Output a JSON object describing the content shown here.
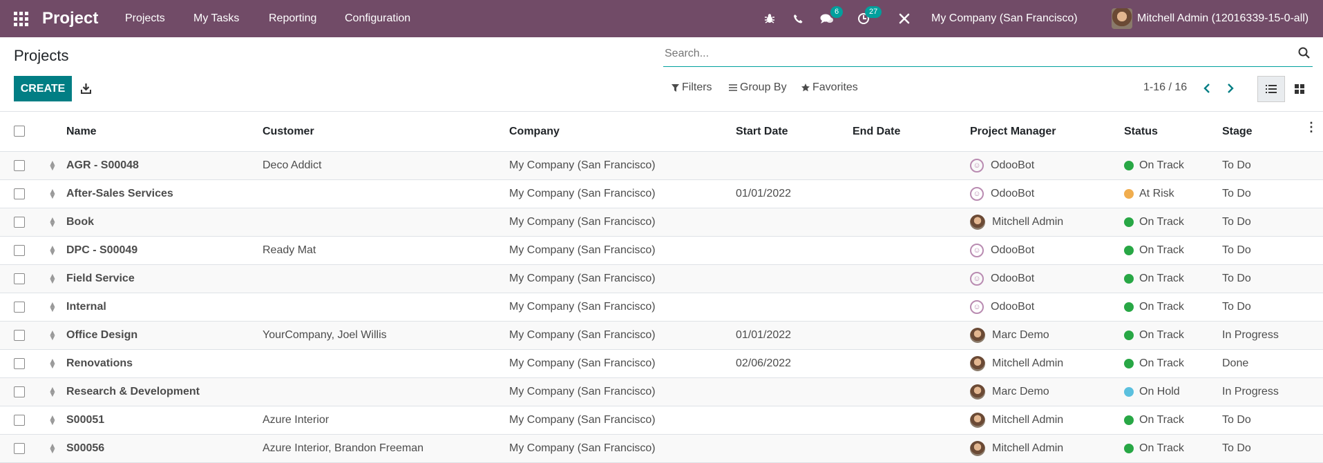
{
  "navbar": {
    "app_title": "Project",
    "menu": [
      "Projects",
      "My Tasks",
      "Reporting",
      "Configuration"
    ],
    "messages_count": "6",
    "activities_count": "27",
    "company": "My Company (San Francisco)",
    "user": "Mitchell Admin (12016339-15-0-all)"
  },
  "control_panel": {
    "title": "Projects",
    "create_label": "CREATE",
    "search_placeholder": "Search...",
    "filters_label": "Filters",
    "groupby_label": "Group By",
    "favorites_label": "Favorites",
    "pager": "1-16 / 16"
  },
  "table": {
    "columns": [
      "Name",
      "Customer",
      "Company",
      "Start Date",
      "End Date",
      "Project Manager",
      "Status",
      "Stage"
    ],
    "rows": [
      {
        "name": "AGR - S00048",
        "customer": "Deco Addict",
        "company": "My Company (San Francisco)",
        "start": "",
        "end": "",
        "manager": "OdooBot",
        "manager_avatar": "bot",
        "status": "On Track",
        "status_color": "#28a745",
        "stage": "To Do"
      },
      {
        "name": "After-Sales Services",
        "customer": "",
        "company": "My Company (San Francisco)",
        "start": "01/01/2022",
        "end": "",
        "manager": "OdooBot",
        "manager_avatar": "bot",
        "status": "At Risk",
        "status_color": "#f0ad4e",
        "stage": "To Do"
      },
      {
        "name": "Book",
        "customer": "",
        "company": "My Company (San Francisco)",
        "start": "",
        "end": "",
        "manager": "Mitchell Admin",
        "manager_avatar": "photo",
        "status": "On Track",
        "status_color": "#28a745",
        "stage": "To Do"
      },
      {
        "name": "DPC - S00049",
        "customer": "Ready Mat",
        "company": "My Company (San Francisco)",
        "start": "",
        "end": "",
        "manager": "OdooBot",
        "manager_avatar": "bot",
        "status": "On Track",
        "status_color": "#28a745",
        "stage": "To Do"
      },
      {
        "name": "Field Service",
        "customer": "",
        "company": "My Company (San Francisco)",
        "start": "",
        "end": "",
        "manager": "OdooBot",
        "manager_avatar": "bot",
        "status": "On Track",
        "status_color": "#28a745",
        "stage": "To Do"
      },
      {
        "name": "Internal",
        "customer": "",
        "company": "My Company (San Francisco)",
        "start": "",
        "end": "",
        "manager": "OdooBot",
        "manager_avatar": "bot",
        "status": "On Track",
        "status_color": "#28a745",
        "stage": "To Do"
      },
      {
        "name": "Office Design",
        "customer": "YourCompany, Joel Willis",
        "company": "My Company (San Francisco)",
        "start": "01/01/2022",
        "end": "",
        "manager": "Marc Demo",
        "manager_avatar": "photo",
        "status": "On Track",
        "status_color": "#28a745",
        "stage": "In Progress"
      },
      {
        "name": "Renovations",
        "customer": "",
        "company": "My Company (San Francisco)",
        "start": "02/06/2022",
        "end": "",
        "manager": "Mitchell Admin",
        "manager_avatar": "photo",
        "status": "On Track",
        "status_color": "#28a745",
        "stage": "Done"
      },
      {
        "name": "Research & Development",
        "customer": "",
        "company": "My Company (San Francisco)",
        "start": "",
        "end": "",
        "manager": "Marc Demo",
        "manager_avatar": "photo",
        "status": "On Hold",
        "status_color": "#5bc0de",
        "stage": "In Progress"
      },
      {
        "name": "S00051",
        "customer": "Azure Interior",
        "company": "My Company (San Francisco)",
        "start": "",
        "end": "",
        "manager": "Mitchell Admin",
        "manager_avatar": "photo",
        "status": "On Track",
        "status_color": "#28a745",
        "stage": "To Do"
      },
      {
        "name": "S00056",
        "customer": "Azure Interior, Brandon Freeman",
        "company": "My Company (San Francisco)",
        "start": "",
        "end": "",
        "manager": "Mitchell Admin",
        "manager_avatar": "photo",
        "status": "On Track",
        "status_color": "#28a745",
        "stage": "To Do"
      }
    ]
  }
}
